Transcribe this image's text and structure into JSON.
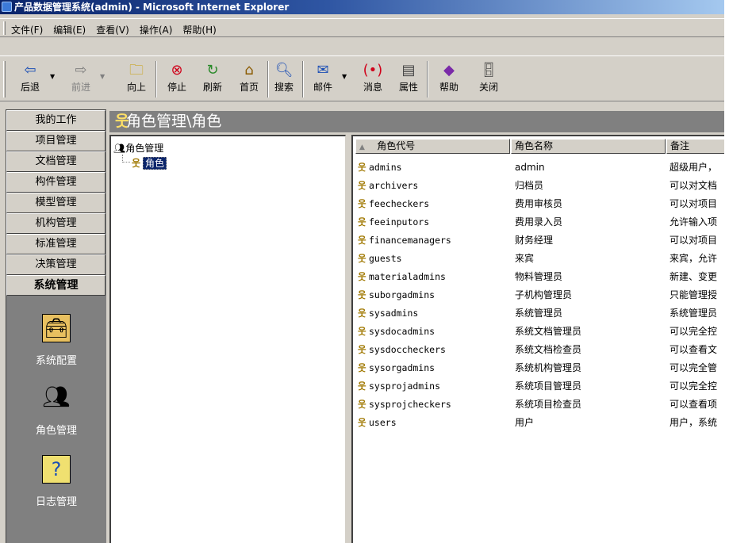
{
  "window": {
    "title": "产品数据管理系统(admin) - Microsoft Internet Explorer"
  },
  "menu": [
    "文件(F)",
    "编辑(E)",
    "查看(V)",
    "操作(A)",
    "帮助(H)"
  ],
  "toolbar": {
    "back": "后退",
    "forward": "前进",
    "up": "向上",
    "stop": "停止",
    "refresh": "刷新",
    "home": "首页",
    "search": "搜索",
    "mail": "邮件",
    "messages": "消息",
    "properties": "属性",
    "help": "帮助",
    "close": "关闭"
  },
  "nav": {
    "items": [
      "我的工作",
      "项目管理",
      "文档管理",
      "构件管理",
      "模型管理",
      "机构管理",
      "标准管理",
      "决策管理"
    ],
    "active": "系统管理",
    "panel": [
      "系统配置",
      "角色管理",
      "日志管理"
    ]
  },
  "header": {
    "title": "角色管理\\角色"
  },
  "tree": {
    "root": "角色管理",
    "child": "角色"
  },
  "list": {
    "columns": [
      "角色代号",
      "角色名称",
      "备注"
    ],
    "rows": [
      {
        "code": "admins",
        "name": "admin",
        "note": "超级用户，"
      },
      {
        "code": "archivers",
        "name": "归档员",
        "note": "可以对文档"
      },
      {
        "code": "feecheckers",
        "name": "费用审核员",
        "note": "可以对项目"
      },
      {
        "code": "feeinputors",
        "name": "费用录入员",
        "note": "允许输入项"
      },
      {
        "code": "financemanagers",
        "name": "财务经理",
        "note": "可以对项目"
      },
      {
        "code": "guests",
        "name": "来宾",
        "note": "来宾，允许"
      },
      {
        "code": "materialadmins",
        "name": "物料管理员",
        "note": "新建、变更"
      },
      {
        "code": "suborgadmins",
        "name": "子机构管理员",
        "note": "只能管理授"
      },
      {
        "code": "sysadmins",
        "name": "系统管理员",
        "note": "系统管理员"
      },
      {
        "code": "sysdocadmins",
        "name": "系统文档管理员",
        "note": "可以完全控"
      },
      {
        "code": "sysdoccheckers",
        "name": "系统文档检查员",
        "note": "可以查看文"
      },
      {
        "code": "sysorgadmins",
        "name": "系统机构管理员",
        "note": "可以完全管"
      },
      {
        "code": "sysprojadmins",
        "name": "系统项目管理员",
        "note": "可以完全控"
      },
      {
        "code": "sysprojcheckers",
        "name": "系统项目检查员",
        "note": "可以查看项"
      },
      {
        "code": "users",
        "name": "用户",
        "note": "用户，系统"
      }
    ]
  }
}
